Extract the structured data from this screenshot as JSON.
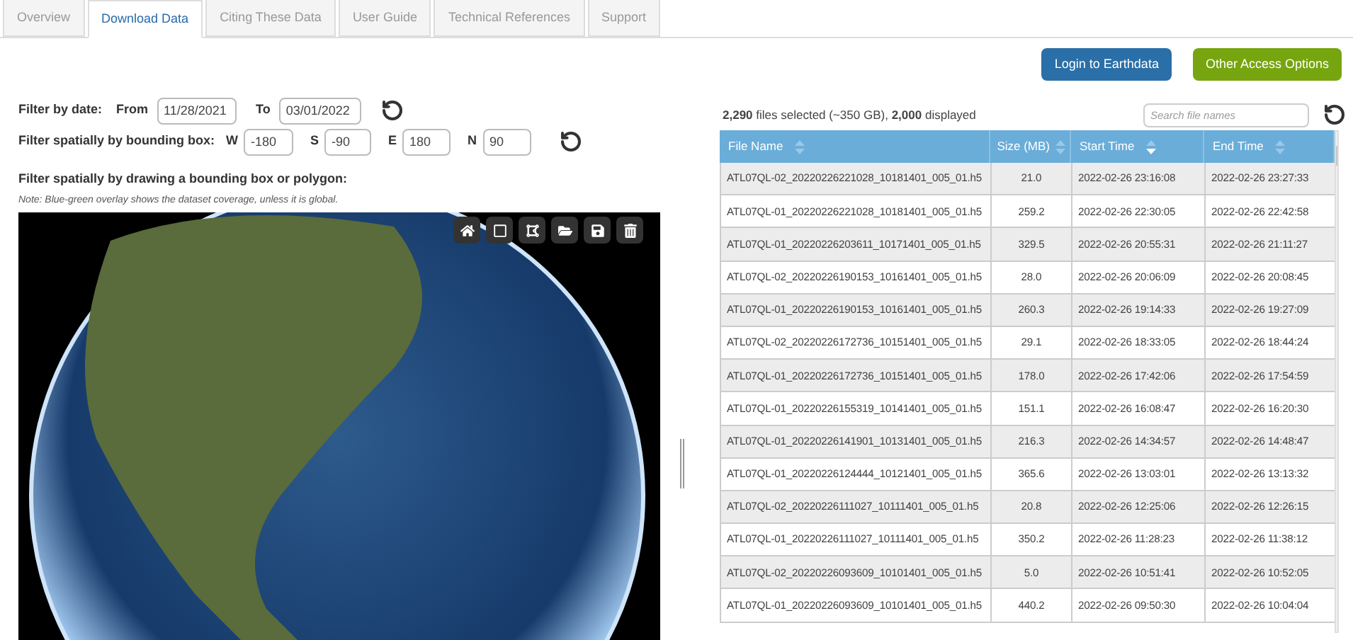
{
  "tabs": [
    {
      "label": "Overview",
      "selected": false
    },
    {
      "label": "Download Data",
      "selected": true
    },
    {
      "label": "Citing These Data",
      "selected": false
    },
    {
      "label": "User Guide",
      "selected": false
    },
    {
      "label": "Technical References",
      "selected": false
    },
    {
      "label": "Support",
      "selected": false
    }
  ],
  "buttons": {
    "login": "Login to Earthdata",
    "other": "Other Access Options"
  },
  "filters": {
    "date_label": "Filter by date:",
    "from_label": "From",
    "from": "11/28/2021",
    "to_label": "To",
    "to": "03/01/2022",
    "bbox_label": "Filter spatially by bounding box:",
    "w_label": "W",
    "w": "-180",
    "s_label": "S",
    "s": "-90",
    "e_label": "E",
    "e": "180",
    "n_label": "N",
    "n": "90",
    "draw_label": "Filter spatially by drawing a bounding box or polygon:",
    "note": "Note: Blue-green overlay shows the dataset coverage, unless it is global."
  },
  "summary": "**2,290** files selected (~350 GB), **2,000** displayed",
  "search": {
    "placeholder": "Search file names"
  },
  "table": {
    "columns": [
      {
        "label": "File Name",
        "sorted": false
      },
      {
        "label": "Size (MB)",
        "sorted": false
      },
      {
        "label": "Start Time",
        "sorted": true
      },
      {
        "label": "End Time",
        "sorted": false
      }
    ],
    "rows": [
      [
        "ATL07QL-02_20220226221028_10181401_005_01.h5",
        "21.0",
        "2022-02-26 23:16:08",
        "2022-02-26 23:27:33"
      ],
      [
        "ATL07QL-01_20220226221028_10181401_005_01.h5",
        "259.2",
        "2022-02-26 22:30:05",
        "2022-02-26 22:42:58"
      ],
      [
        "ATL07QL-01_20220226203611_10171401_005_01.h5",
        "329.5",
        "2022-02-26 20:55:31",
        "2022-02-26 21:11:27"
      ],
      [
        "ATL07QL-02_20220226190153_10161401_005_01.h5",
        "28.0",
        "2022-02-26 20:06:09",
        "2022-02-26 20:08:45"
      ],
      [
        "ATL07QL-01_20220226190153_10161401_005_01.h5",
        "260.3",
        "2022-02-26 19:14:33",
        "2022-02-26 19:27:09"
      ],
      [
        "ATL07QL-02_20220226172736_10151401_005_01.h5",
        "29.1",
        "2022-02-26 18:33:05",
        "2022-02-26 18:44:24"
      ],
      [
        "ATL07QL-01_20220226172736_10151401_005_01.h5",
        "178.0",
        "2022-02-26 17:42:06",
        "2022-02-26 17:54:59"
      ],
      [
        "ATL07QL-01_20220226155319_10141401_005_01.h5",
        "151.1",
        "2022-02-26 16:08:47",
        "2022-02-26 16:20:30"
      ],
      [
        "ATL07QL-01_20220226141901_10131401_005_01.h5",
        "216.3",
        "2022-02-26 14:34:57",
        "2022-02-26 14:48:47"
      ],
      [
        "ATL07QL-01_20220226124444_10121401_005_01.h5",
        "365.6",
        "2022-02-26 13:03:01",
        "2022-02-26 13:13:32"
      ],
      [
        "ATL07QL-02_20220226111027_10111401_005_01.h5",
        "20.8",
        "2022-02-26 12:25:06",
        "2022-02-26 12:26:15"
      ],
      [
        "ATL07QL-01_20220226111027_10111401_005_01.h5",
        "350.2",
        "2022-02-26 11:28:23",
        "2022-02-26 11:38:12"
      ],
      [
        "ATL07QL-02_20220226093609_10101401_005_01.h5",
        "5.0",
        "2022-02-26 10:51:41",
        "2022-02-26 10:52:05"
      ],
      [
        "ATL07QL-01_20220226093609_10101401_005_01.h5",
        "440.2",
        "2022-02-26 09:50:30",
        "2022-02-26 10:04:04"
      ]
    ]
  }
}
